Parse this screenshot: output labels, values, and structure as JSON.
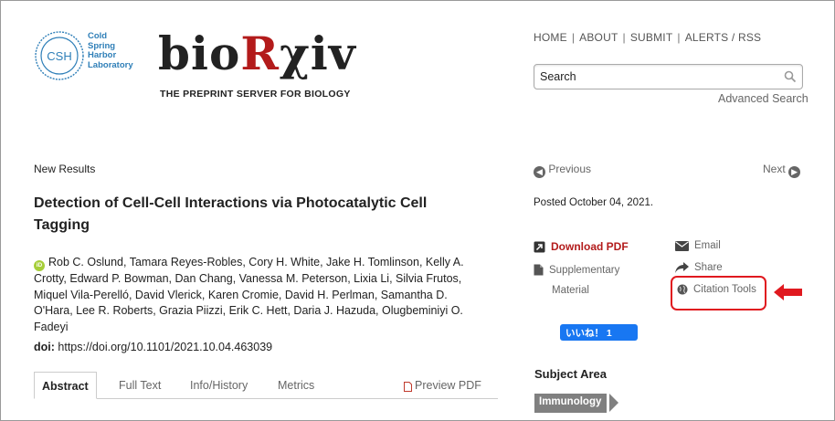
{
  "header": {
    "csh_lines": [
      "Cold",
      "Spring",
      "Harbor",
      "Laboratory"
    ],
    "csh_badge": "CSH",
    "brand_prefix": "bio",
    "brand_r": "R",
    "brand_suffix": "χiv",
    "tagline": "THE PREPRINT SERVER FOR BIOLOGY",
    "nav": [
      "HOME",
      "ABOUT",
      "SUBMIT",
      "ALERTS / RSS"
    ],
    "search_placeholder": "Search",
    "advanced_search": "Advanced Search"
  },
  "article": {
    "section_label": "New Results",
    "title": "Detection of Cell-Cell Interactions via Photocatalytic Cell Tagging",
    "authors_text": "Rob C. Oslund, Tamara Reyes-Robles, Cory H. White, Jake H. Tomlinson, Kelly A. Crotty, Edward P. Bowman, Dan Chang, Vanessa M. Peterson, Lixia Li, Silvia Frutos, Miquel Vila-Perelló, David Vlerick, Karen Cromie, David H. Perlman, Samantha D. O'Hara, Lee R. Roberts, Grazia Piizzi, Erik C. Hett, Daria J. Hazuda, Olugbeminiyi O. Fadeyi",
    "doi_label": "doi:",
    "doi_value": "https://doi.org/10.1101/2021.10.04.463039",
    "tabs": [
      "Abstract",
      "Full Text",
      "Info/History",
      "Metrics",
      "Preview PDF"
    ]
  },
  "sidebar": {
    "previous": "Previous",
    "next": "Next",
    "posted": "Posted October 04, 2021.",
    "download_pdf": "Download PDF",
    "supplementary": "Supplementary",
    "material": "Material",
    "email": "Email",
    "share": "Share",
    "citation_tools": "Citation Tools",
    "like_label": "いいね！ 1",
    "subject_area_heading": "Subject Area",
    "subject_tag": "Immunology"
  },
  "colors": {
    "brand_red": "#b31b1b",
    "highlight_red": "#e0191f",
    "csh_blue": "#2f7fb8",
    "facebook_blue": "#1877f2",
    "orcid_green": "#a6ce39"
  },
  "icons": [
    "csh-logo-icon",
    "search-icon",
    "previous-arrow-icon",
    "next-arrow-icon",
    "download-pdf-icon",
    "supplementary-file-icon",
    "email-icon",
    "share-icon",
    "globe-icon",
    "red-arrow-icon",
    "orcid-icon",
    "pdf-file-icon"
  ]
}
